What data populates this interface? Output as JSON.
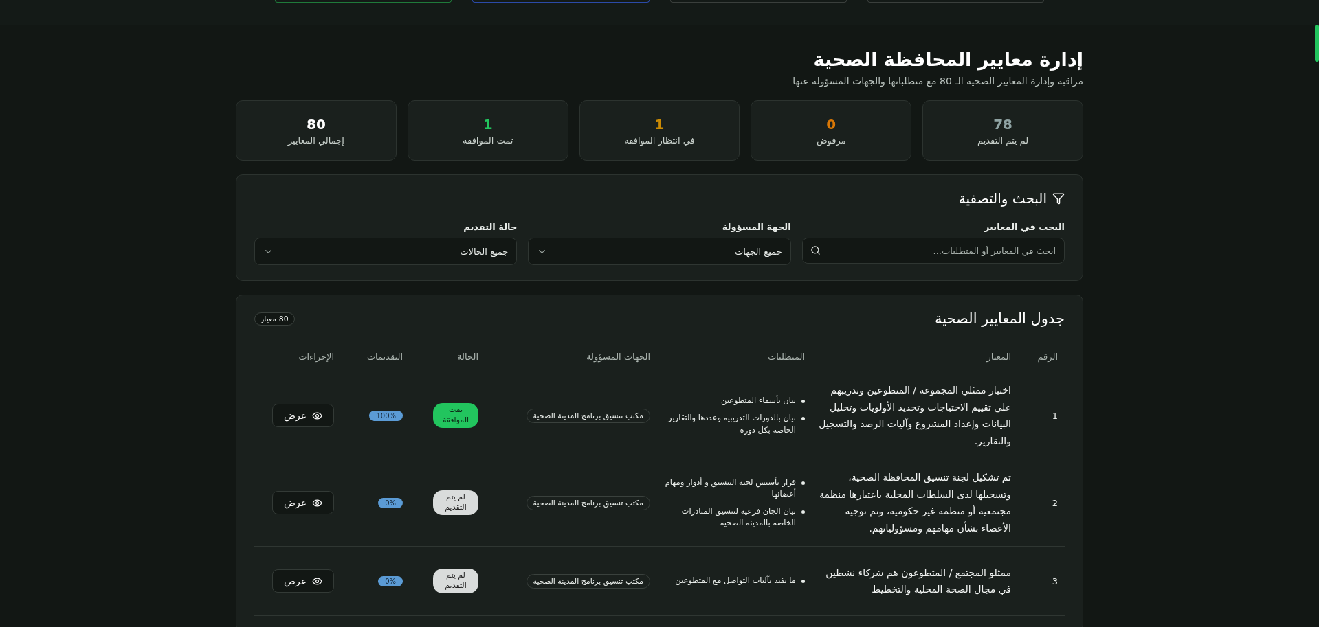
{
  "header": {
    "tabs": [
      {
        "color": "#3a3f3c"
      },
      {
        "color": "#3a3f3c"
      },
      {
        "color": "#2b4aa8"
      },
      {
        "color": "#1f7a3a"
      }
    ]
  },
  "page": {
    "title": "إدارة معايير المحافظة الصحية",
    "subtitle": "مراقبة وإدارة المعايير الصحية الـ 80 مع متطلباتها والجهات المسؤولة عنها"
  },
  "stats": [
    {
      "value": "78",
      "label": "لم يتم التقديم",
      "color": "#8fa3a3"
    },
    {
      "value": "0",
      "label": "مرفوض",
      "color": "#d97706"
    },
    {
      "value": "1",
      "label": "في انتظار الموافقة",
      "color": "#ca8a04"
    },
    {
      "value": "1",
      "label": "تمت الموافقة",
      "color": "#22c55e"
    },
    {
      "value": "80",
      "label": "إجمالي المعايير",
      "color": "#ffffff"
    }
  ],
  "filters": {
    "title": "البحث والتصفية",
    "fields": [
      {
        "kind": "search",
        "label": "البحث في المعايير",
        "placeholder": "ابحث في المعايير أو المتطلبات..."
      },
      {
        "kind": "select",
        "label": "الجهة المسؤولة",
        "value": "جميع الجهات"
      },
      {
        "kind": "select",
        "label": "حالة التقديم",
        "value": "جميع الحالات"
      }
    ]
  },
  "table": {
    "title": "جدول المعايير الصحية",
    "count": "80 معيار",
    "columns": [
      "الرقم",
      "المعيار",
      "المتطلبات",
      "الجهات المسؤولة",
      "الحالة",
      "التقديمات",
      "الإجراءات"
    ],
    "rows": [
      {
        "number": "1",
        "criterion": "اختيار ممثلي المجموعة / المتطوعين وتدريبهم على تقييم الاحتياجات وتحديد الأولويات وتحليل البيانات وإعداد المشروع وآليات الرصد والتسجيل والتقارير.",
        "requirements": [
          "بيان بأسماء المتطوعين",
          "بيان بالدورات التدريبيه وعددها والتقارير الخاصه بكل دوره"
        ],
        "agency": "مكتب تنسيق برنامج المدينة الصحية",
        "status": {
          "kind": "approved",
          "label": "تمت الموافقة"
        },
        "progress": "100%",
        "action": "عرض"
      },
      {
        "number": "2",
        "criterion": "تم تشكيل لجنة تنسيق المحافظة الصحية، وتسجيلها لدى السلطات المحلية باعتبارها منظمة مجتمعية أو منظمة غير حكومية، وتم توجيه الأعضاء بشأن مهامهم ومسؤولياتهم.",
        "requirements": [
          "قرار تأسيس لجنة التنسيق و أدوار ومهام أعضائها",
          "بيان الجان فرعية لتنسيق المبادرات الخاصه بالمدينه الصحيه"
        ],
        "agency": "مكتب تنسيق برنامج المدينة الصحية",
        "status": {
          "kind": "not_submitted",
          "label": "لم يتم التقديم"
        },
        "progress": "0%",
        "action": "عرض"
      },
      {
        "number": "3",
        "criterion": "ممثلو المجتمع / المتطوعون هم شركاء نشطين في مجال الصحة المحلية والتخطيط",
        "requirements": [
          "ما يفيد بآليات التواصل مع المتطوعين"
        ],
        "agency": "مكتب تنسيق برنامج المدينة الصحية",
        "status": {
          "kind": "not_submitted",
          "label": "لم يتم التقديم"
        },
        "progress": "0%",
        "action": "عرض"
      }
    ]
  }
}
